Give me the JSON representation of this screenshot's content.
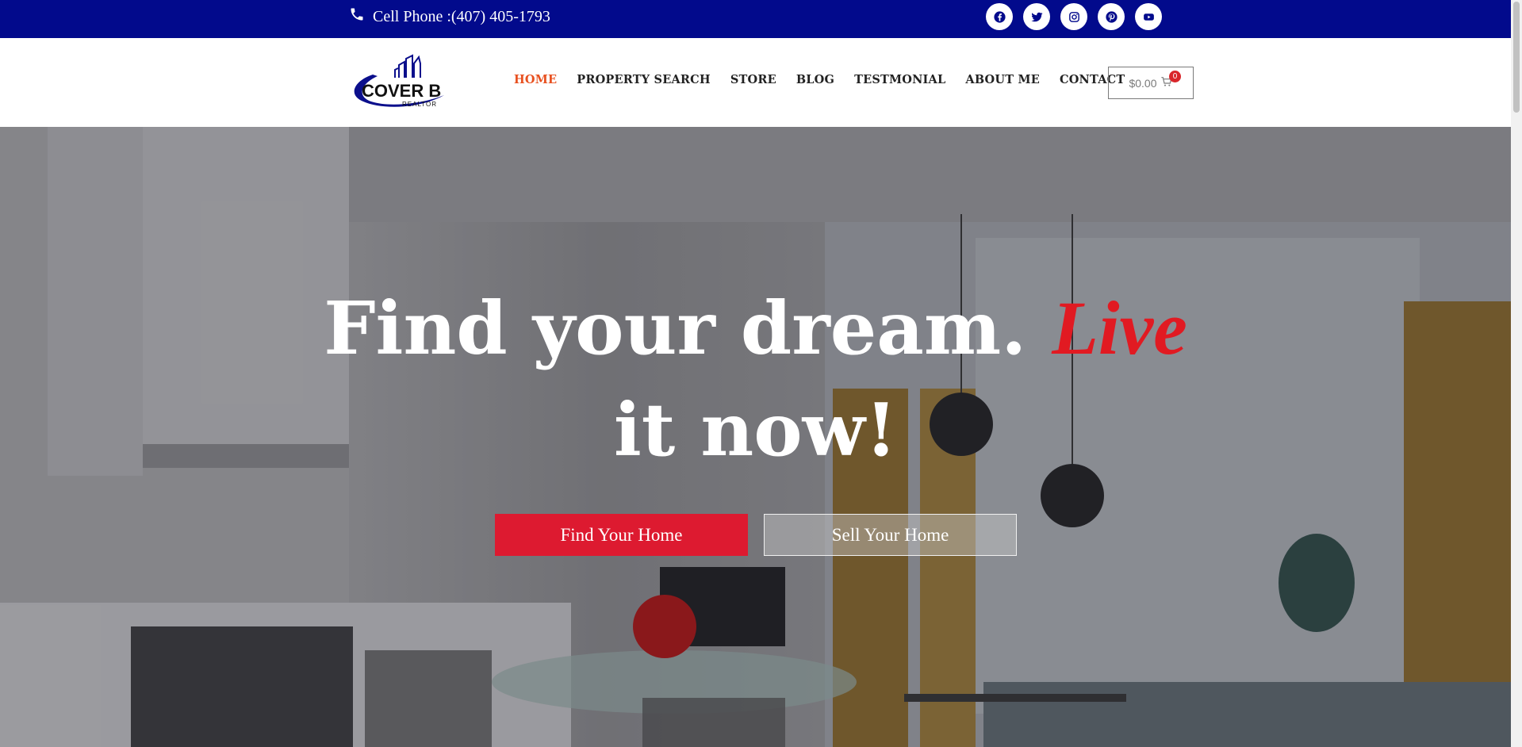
{
  "topbar": {
    "phone_text": "Cell Phone :(407) 405-1793",
    "socials": [
      "facebook-icon",
      "twitter-icon",
      "instagram-icon",
      "pinterest-icon",
      "youtube-icon"
    ]
  },
  "logo": {
    "main": "COVER B",
    "sub": "REALTOR"
  },
  "nav": {
    "items": [
      "HOME",
      "PROPERTY SEARCH",
      "STORE",
      "BLOG",
      "TESTMONIAL",
      "ABOUT ME",
      "CONTACT"
    ],
    "active": "HOME"
  },
  "cart": {
    "amount": "$0.00",
    "count": "0"
  },
  "hero": {
    "headline_part1": "Find your dream.",
    "headline_script": "Live",
    "headline_part2": "it now!",
    "find_button": "Find Your Home",
    "sell_button": "Sell Your Home"
  },
  "colors": {
    "topbar": "#020a8c",
    "accent": "#e8501f",
    "button_red": "#dd1a30",
    "script_red": "#e11a22"
  }
}
